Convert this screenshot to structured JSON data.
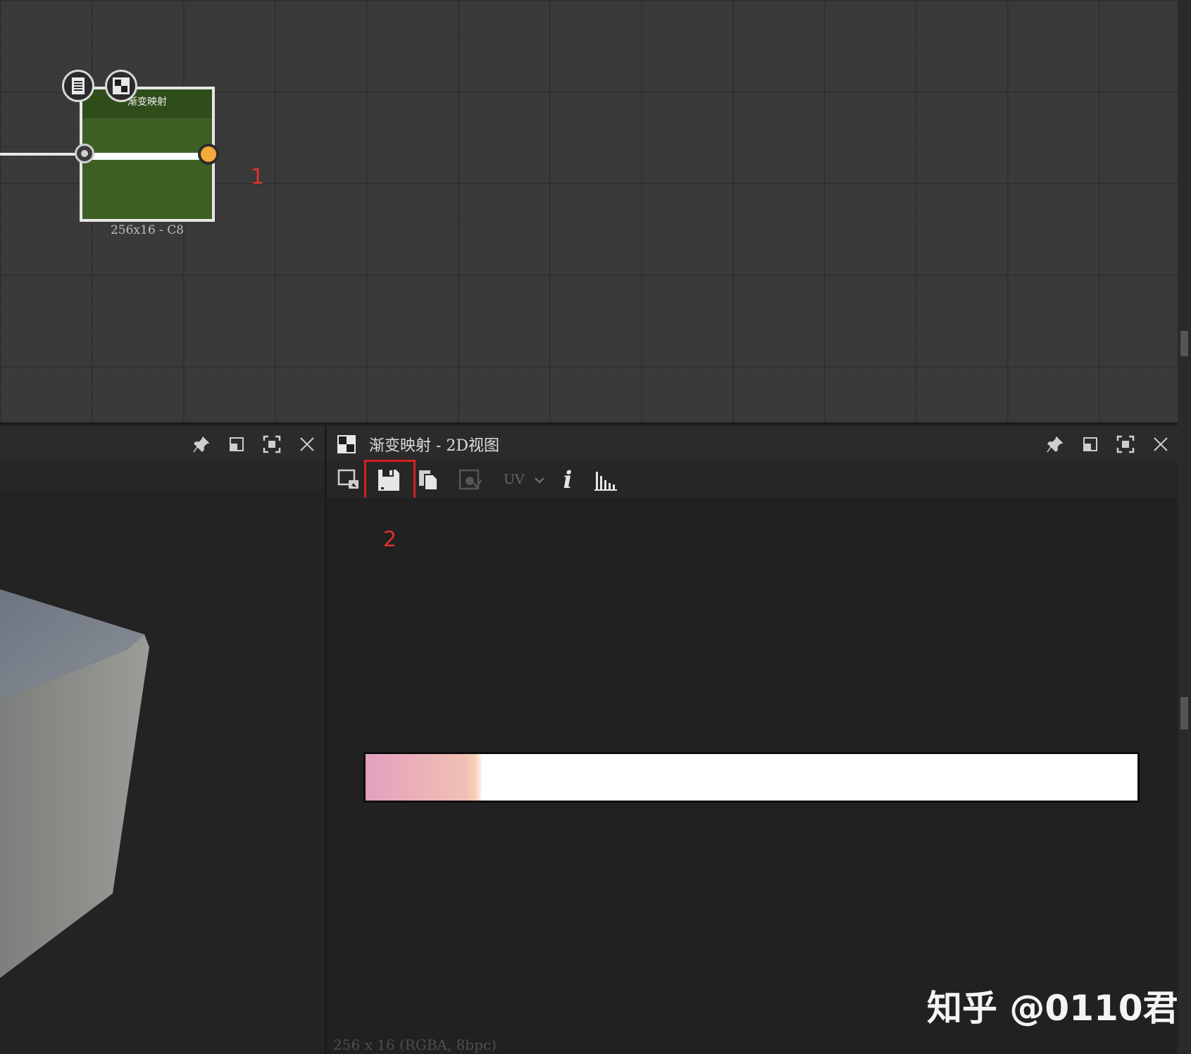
{
  "graph": {
    "node": {
      "title": "渐变映射",
      "info": "256x16 - C8"
    },
    "annotation_1": "1"
  },
  "viewport_3d": {
    "toolbar_buttons": [
      "pin-icon",
      "float-icon",
      "maximize-icon",
      "close-icon"
    ]
  },
  "view_2d": {
    "title": "渐变映射 - 2D视图",
    "toolbar": {
      "uv_label": "UV",
      "info_label": "i"
    },
    "annotation_2": "2",
    "status": "256 x 16 (RGBA, 8bpc)",
    "gradient_colors": [
      "#e3a0be",
      "#f1c0b4",
      "#ffffff"
    ]
  },
  "watermark": "知乎 @0110君",
  "colors": {
    "node_body": "#3e5f24",
    "output_port": "#f3a83a",
    "highlight": "#d62020"
  }
}
